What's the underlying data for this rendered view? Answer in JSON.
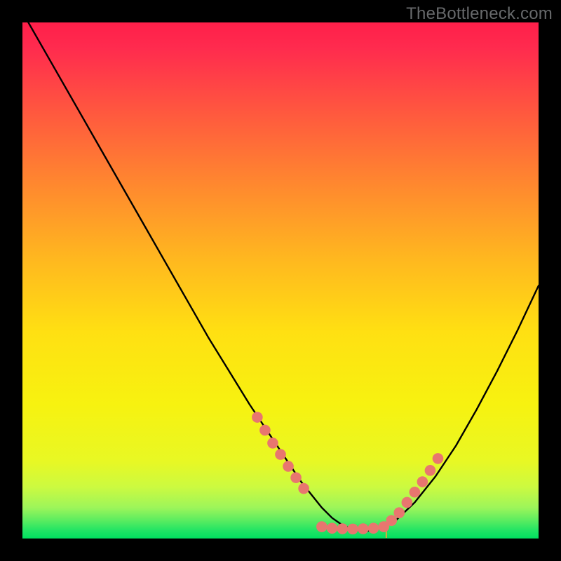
{
  "watermark": "TheBottleneck.com",
  "colors": {
    "background": "#000000",
    "gradient_top": "#ff1f4a",
    "gradient_mid": "#ffe000",
    "gradient_bottom": "#00e060",
    "curve": "#000000",
    "marker_fill": "#e8766f",
    "marker_stroke": "#d85a53"
  },
  "chart_data": {
    "type": "line",
    "title": "",
    "xlabel": "",
    "ylabel": "",
    "xlim": [
      0,
      100
    ],
    "ylim": [
      0,
      100
    ],
    "grid": false,
    "series": [
      {
        "name": "bottleneck-curve",
        "x": [
          0,
          4,
          8,
          12,
          16,
          20,
          24,
          28,
          32,
          36,
          40,
          44,
          48,
          52,
          54,
          56,
          58,
          60,
          62,
          64,
          66,
          68,
          72,
          76,
          80,
          84,
          88,
          92,
          96,
          100
        ],
        "y": [
          102,
          95,
          88,
          81,
          74,
          67,
          60,
          53,
          46,
          39,
          32.5,
          26,
          20,
          14,
          11,
          8.5,
          6,
          4,
          2.6,
          1.8,
          1.4,
          1.6,
          3.2,
          7,
          12,
          18,
          25,
          32.5,
          40.5,
          49
        ]
      }
    ],
    "markers": [
      {
        "name": "left-cluster",
        "x": [
          45.5,
          47.0,
          48.5,
          50.0,
          51.5,
          53.0,
          54.5
        ],
        "y": [
          23.5,
          21.0,
          18.5,
          16.3,
          14.0,
          11.8,
          9.7
        ]
      },
      {
        "name": "floor-cluster",
        "x": [
          58.0,
          60.0,
          62.0,
          64.0,
          66.0,
          68.0,
          70.0
        ],
        "y": [
          2.3,
          2.0,
          1.9,
          1.85,
          1.9,
          2.0,
          2.3
        ]
      },
      {
        "name": "right-cluster",
        "x": [
          71.5,
          73.0,
          74.5,
          76.0,
          77.5,
          79.0,
          80.5
        ],
        "y": [
          3.5,
          5.0,
          7.0,
          9.0,
          11.0,
          13.2,
          15.5
        ]
      }
    ],
    "tick_marker": {
      "x": 70.5,
      "half_height_pct": 1.3
    }
  }
}
